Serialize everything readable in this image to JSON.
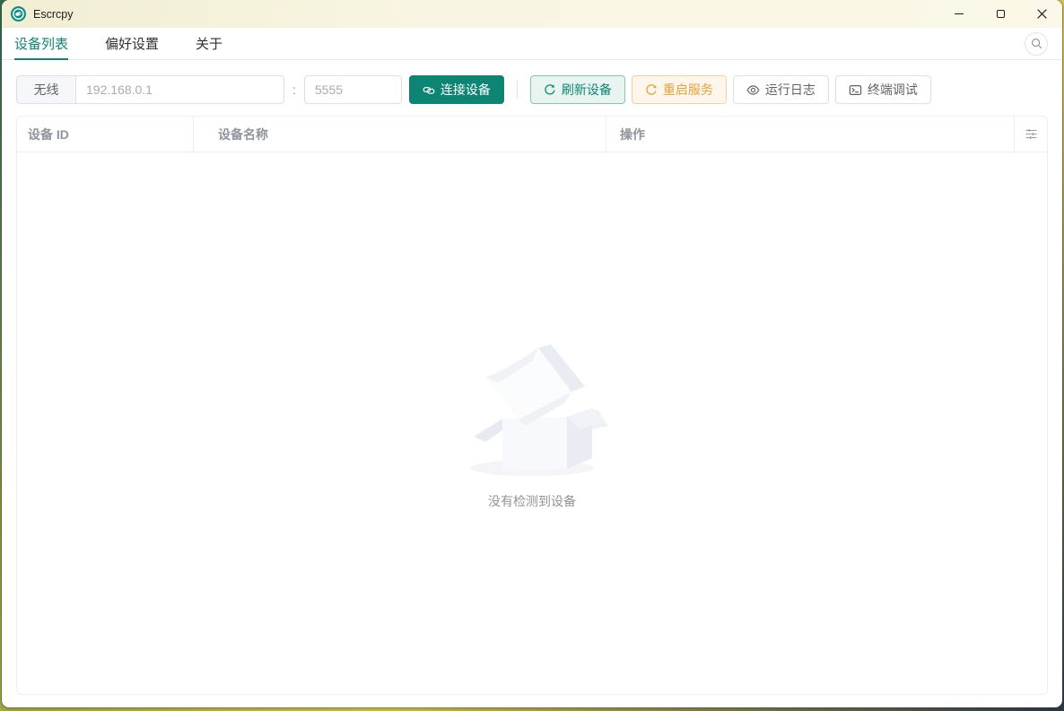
{
  "window": {
    "title": "Escrcpy"
  },
  "tabs": [
    {
      "label": "设备列表",
      "active": true
    },
    {
      "label": "偏好设置",
      "active": false
    },
    {
      "label": "关于",
      "active": false
    }
  ],
  "toolbar": {
    "mode_label": "无线",
    "host_placeholder": "192.168.0.1",
    "separator": ":",
    "port_placeholder": "5555",
    "connect_label": "连接设备",
    "refresh_label": "刷新设备",
    "restart_label": "重启服务",
    "logs_label": "运行日志",
    "terminal_label": "终端调试"
  },
  "table": {
    "columns": [
      "设备 ID",
      "设备名称",
      "操作"
    ],
    "rows": [],
    "empty_text": "没有检测到设备"
  },
  "icons": {
    "app": "escrcpy-logo",
    "search": "magnifier",
    "connect": "chain-link",
    "refresh": "refresh-circular-arrows",
    "restart": "refresh-right",
    "logs": "eye",
    "terminal": "terminal-prompt",
    "table_settings": "sliders",
    "minimize": "—",
    "maximize": "□",
    "close": "✕"
  },
  "colors": {
    "primary": "#0e8573",
    "warning": "#e6a23c",
    "titlebar": "#f8f5e2",
    "border": "#dcdfe6",
    "table_border": "#ebeef5",
    "muted_text": "#909399"
  }
}
